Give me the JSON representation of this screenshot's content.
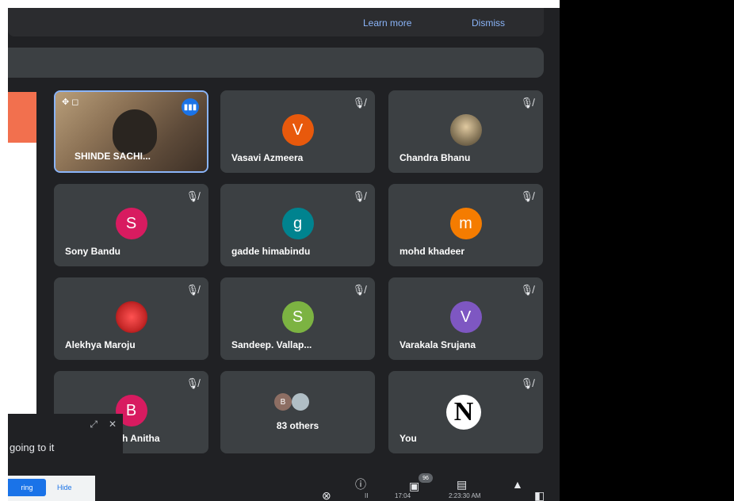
{
  "banner": {
    "learn_more": "Learn more",
    "dismiss": "Dismiss"
  },
  "participants": {
    "presenter_video": {
      "name": "SHINDE SACHI..."
    },
    "tiles": [
      {
        "name": "Vasavi Azmeera",
        "initial": "V",
        "color": "#e8590c"
      },
      {
        "name": "Chandra Bhanu",
        "initial": "",
        "color": "#8a7a5c"
      },
      {
        "name": "Sony Bandu",
        "initial": "S",
        "color": "#d81b60"
      },
      {
        "name": "gadde himabindu",
        "initial": "g",
        "color": "#00838f"
      },
      {
        "name": "mohd khadeer",
        "initial": "m",
        "color": "#f57c00"
      },
      {
        "name": "Alekhya Maroju",
        "initial": "",
        "color": "#c62828"
      },
      {
        "name": "Sandeep. Vallap...",
        "initial": "S",
        "color": "#7cb342"
      },
      {
        "name": "Varakala Srujana",
        "initial": "V",
        "color": "#7e57c2"
      },
      {
        "name": "h Anitha",
        "initial": "B",
        "color": "#d81b60"
      }
    ],
    "others": {
      "label": "83 others",
      "initial": "B"
    },
    "you": {
      "label": "You",
      "logo_letter": "N"
    }
  },
  "captions": {
    "text": "going to it"
  },
  "bottom_left": {
    "button_label": "ring",
    "hide_label": "Hide"
  },
  "dock": {
    "badge": "96",
    "left_text": "II",
    "time1": "17:04",
    "time2": "2:23:30 AM"
  },
  "colors": {
    "meeting_bg": "#202124",
    "tile_bg": "#3c4043",
    "accent": "#1a73e8",
    "link": "#8ab4f8"
  }
}
